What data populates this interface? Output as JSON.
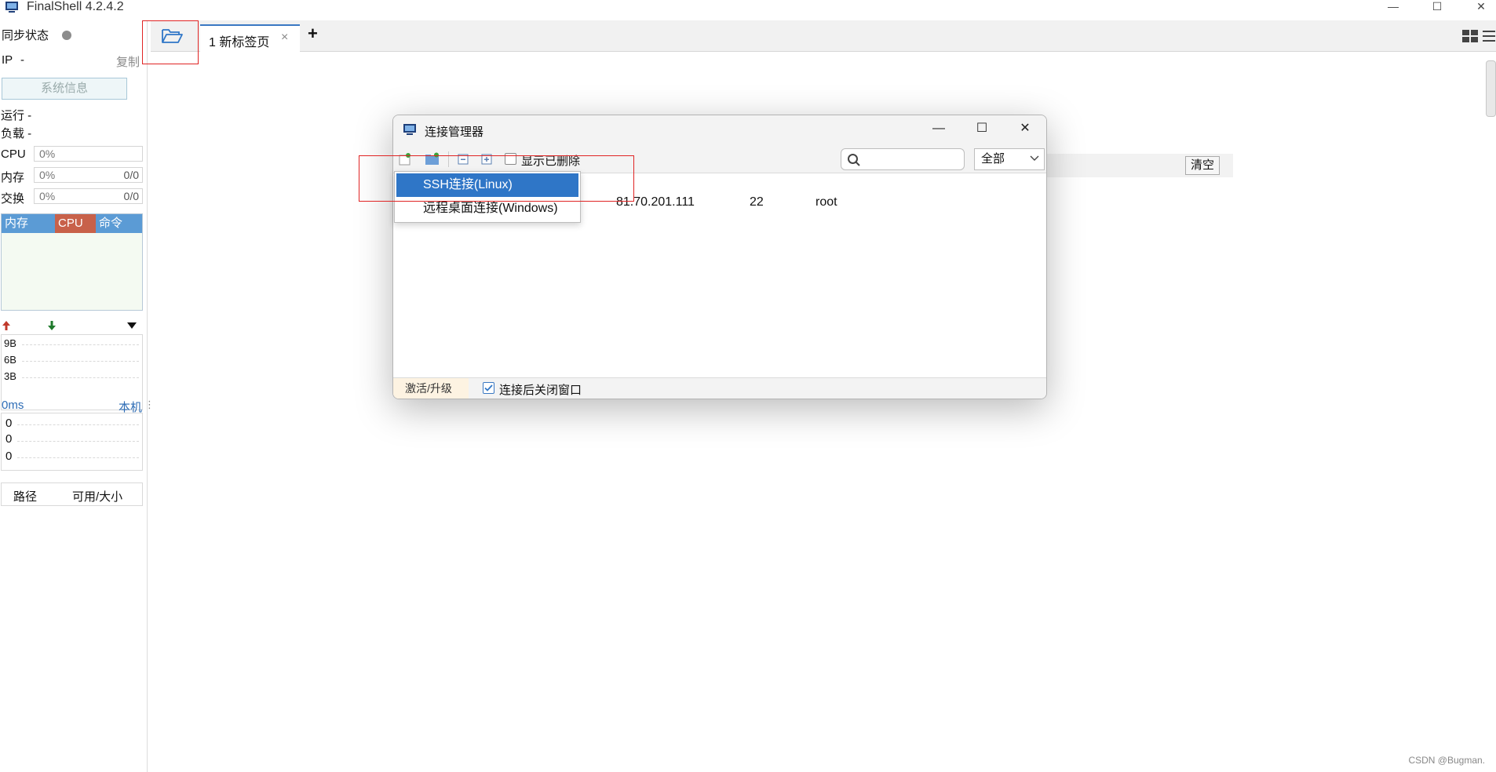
{
  "app": {
    "title": "FinalShell 4.2.4.2"
  },
  "left_panel": {
    "sync_label": "同步状态",
    "ip_label": "IP",
    "ip_value": "-",
    "copy_label": "复制",
    "sysinfo_label": "系统信息",
    "run_label": "运行 -",
    "load_label": "负载 -",
    "cpu_label": "CPU",
    "cpu_value": "0%",
    "mem_label": "内存",
    "mem_value": "0%",
    "mem_ratio": "0/0",
    "swap_label": "交换",
    "swap_value": "0%",
    "swap_ratio": "0/0",
    "proc_cols": [
      "内存",
      "CPU",
      "命令"
    ],
    "net_ticks": [
      "9B",
      "6B",
      "3B"
    ],
    "latency": "0ms",
    "local_label": "本机",
    "ping_rows": [
      "0",
      "0",
      "0"
    ],
    "disk_cols": [
      "路径",
      "可用/大小"
    ]
  },
  "tabs": {
    "items": [
      {
        "label": "1 新标签页",
        "close": "×"
      }
    ],
    "add": "+"
  },
  "background": {
    "clear_label": "清空"
  },
  "dialog": {
    "title": "连接管理器",
    "minimize": "—",
    "maximize": "☐",
    "close": "✕",
    "show_deleted_label": "显示已删除",
    "filter_value": "全部",
    "row": {
      "host": "81.70.201.111",
      "port": "22",
      "user": "root"
    },
    "upgrade_label": "激活/升级",
    "close_after_connect_label": "连接后关闭窗口"
  },
  "menu": {
    "items": [
      {
        "label": "SSH连接(Linux)",
        "selected": true
      },
      {
        "label": "远程桌面连接(Windows)",
        "selected": false
      }
    ]
  },
  "watermark": "CSDN @Bugman.",
  "colors": {
    "accent": "#2f76c7",
    "highlight": "#e02424",
    "cpu_col": "#c8614a",
    "mem_col": "#5b9bd5"
  }
}
